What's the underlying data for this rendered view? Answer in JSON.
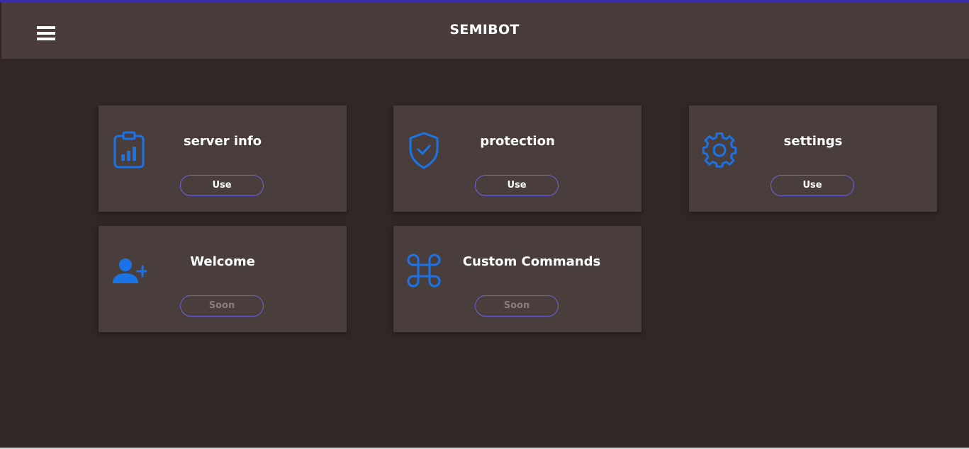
{
  "header": {
    "brand": "SEMIBOT",
    "menu_icon": "hamburger-menu-icon"
  },
  "cards": [
    {
      "title": "server info",
      "button": "Use",
      "icon": "clipboard-chart-icon",
      "enabled": true
    },
    {
      "title": "protection",
      "button": "Use",
      "icon": "shield-check-icon",
      "enabled": true
    },
    {
      "title": "settings",
      "button": "Use",
      "icon": "gear-icon",
      "enabled": true
    },
    {
      "title": "Welcome",
      "button": "Soon",
      "icon": "user-plus-icon",
      "enabled": false
    },
    {
      "title": "Custom Commands",
      "button": "Soon",
      "icon": "command-key-icon",
      "enabled": false
    }
  ],
  "colors": {
    "background": "#302726",
    "header": "#4a3c3b",
    "card": "#4a3e3d",
    "accent_icon": "#1a74e8",
    "button_border": "#6c63d8",
    "top_line": "#3b2ea8"
  }
}
